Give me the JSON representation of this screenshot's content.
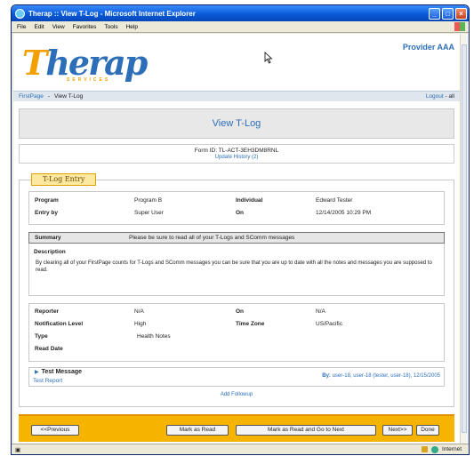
{
  "window": {
    "title": "Therap :: View T-Log - Microsoft Internet Explorer"
  },
  "menu": [
    "File",
    "Edit",
    "View",
    "Favorites",
    "Tools",
    "Help"
  ],
  "header": {
    "logo_text": "Therap",
    "logo_sub": "SERVICES",
    "provider": "Provider AAA"
  },
  "nav": {
    "first_page": "FirstPage",
    "separator": "-",
    "current": "View T-Log",
    "logout": "Logout",
    "logout_suffix": "- all"
  },
  "page_title": "View T-Log",
  "form": {
    "form_id": "Form ID: TL-ACT-3EH3DM8RNL",
    "update_history": "Update History (2)"
  },
  "entry_tab": "T-Log Entry",
  "details": {
    "program_label": "Program",
    "program_value": "Program B",
    "individual_label": "Individual",
    "individual_value": "Edward Tester",
    "entry_by_label": "Entry by",
    "entry_by_value": "Super User",
    "on_label": "On",
    "on_value": "12/14/2005 10:29 PM"
  },
  "summary": {
    "label": "Summary",
    "value": "Please be sure to read all of your T-Logs and SComm messages"
  },
  "description": {
    "label": "Description",
    "text": "By clearing all of your FirstPage counts for T-Logs and SComm messages you can be sure that you are up to date with all the notes and messages you are supposed to read."
  },
  "meta": {
    "reporter_label": "Reporter",
    "reporter_value": "N/A",
    "on_label": "On",
    "on_value": "N/A",
    "notification_label": "Notification Level",
    "notification_value": "High",
    "timezone_label": "Time Zone",
    "timezone_value": "US/Pacific",
    "type_label": "Type",
    "type_value": "Health Notes",
    "read_date_label": "Read Date"
  },
  "test_message": {
    "title": "Test Message",
    "report": "Test Report",
    "by_label": "By:",
    "by_value": "user-18, user-18 (tester, user-18),",
    "date": "12/15/2005"
  },
  "add_followup": "Add Followup",
  "buttons": {
    "previous": "<<Previous",
    "mark_read": "Mark as Read",
    "mark_read_next": "Mark as Read and Go to Next",
    "next": "Next>>",
    "done": "Done"
  },
  "status": {
    "zone": "Internet"
  },
  "colors": {
    "brand": "#2c6fb8",
    "accent": "#f6b400"
  }
}
